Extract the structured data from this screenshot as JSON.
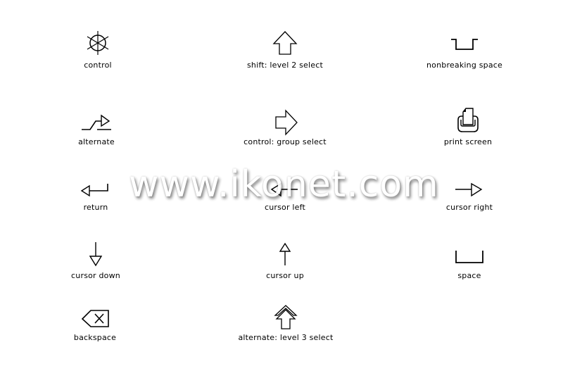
{
  "watermark": "www.ikonet.com",
  "symbols": [
    {
      "id": "control",
      "label": "control",
      "icon": "helm-icon"
    },
    {
      "id": "shift",
      "label": "shift: level 2 select",
      "icon": "up-arrow-outline-icon"
    },
    {
      "id": "nonbreaking-space",
      "label": "nonbreaking space",
      "icon": "nonbreaking-space-icon"
    },
    {
      "id": "alternate",
      "label": "alternate",
      "icon": "alternate-icon"
    },
    {
      "id": "control-group",
      "label": "control: group select",
      "icon": "right-arrow-outline-icon"
    },
    {
      "id": "print-screen",
      "label": "print screen",
      "icon": "print-screen-icon"
    },
    {
      "id": "return",
      "label": "return",
      "icon": "return-icon"
    },
    {
      "id": "cursor-left",
      "label": "cursor left",
      "icon": "left-arrow-icon"
    },
    {
      "id": "cursor-right",
      "label": "cursor right",
      "icon": "right-arrow-icon"
    },
    {
      "id": "cursor-down",
      "label": "cursor down",
      "icon": "down-arrow-icon"
    },
    {
      "id": "cursor-up",
      "label": "cursor up",
      "icon": "up-arrow-icon"
    },
    {
      "id": "space",
      "label": "space",
      "icon": "space-icon"
    },
    {
      "id": "backspace",
      "label": "backspace",
      "icon": "backspace-icon"
    },
    {
      "id": "alternate-level3",
      "label": "alternate: level 3 select",
      "icon": "double-up-arrow-icon"
    }
  ]
}
